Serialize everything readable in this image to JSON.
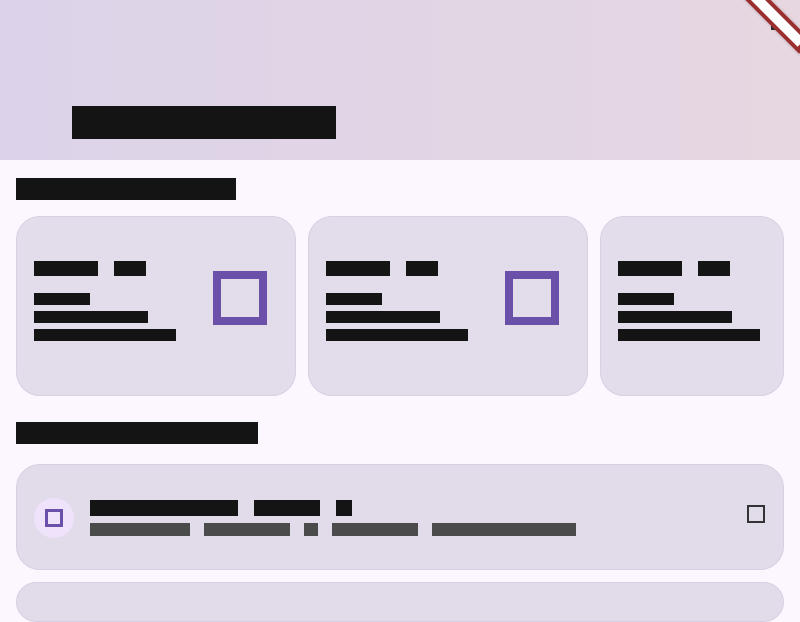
{
  "colors": {
    "accent": "#6a50a8",
    "background": "#fcf7ff",
    "header_gradient": [
      "#dcd3ea",
      "#e6d7e0"
    ],
    "card": "#e3dceb",
    "debug_ribbon": "#9b2f2f"
  },
  "icons": {
    "top_right": "square-outline-icon",
    "card_square": "square-outline-icon",
    "tile_square": "square-outline-icon",
    "avatar": "square-outline-icon"
  }
}
